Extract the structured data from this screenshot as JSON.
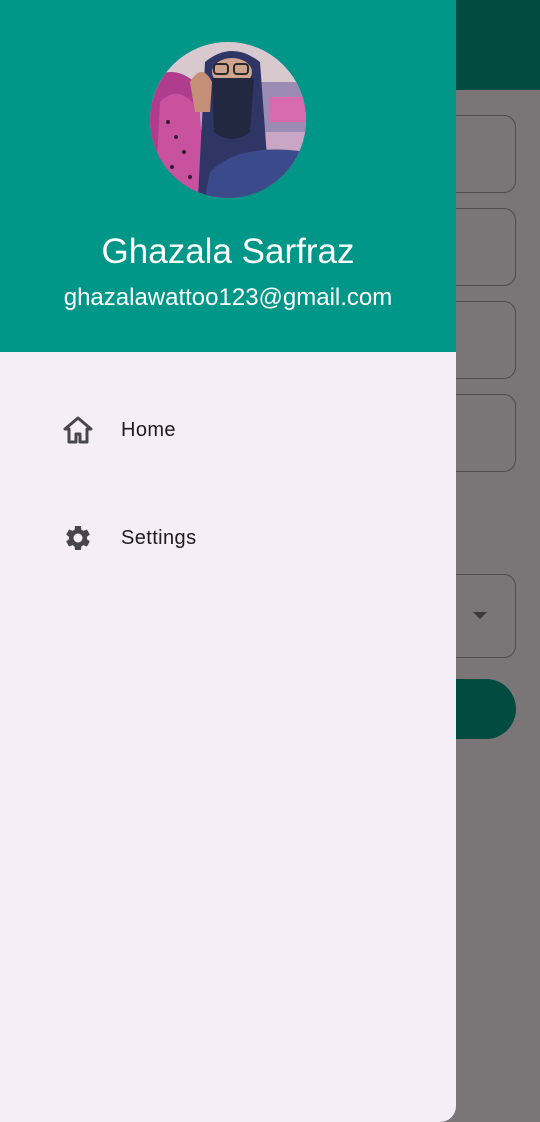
{
  "drawer": {
    "account": {
      "name": "Ghazala Sarfraz",
      "email": "ghazalawattoo123@gmail.com",
      "avatar": "profile-photo"
    },
    "items": [
      {
        "label": "Home",
        "icon": "home-icon"
      },
      {
        "label": "Settings",
        "icon": "gear-icon"
      }
    ]
  },
  "colors": {
    "header": "#009688",
    "drawer_bg": "#f6eef7",
    "scrim": "#7a7577",
    "appbar": "#024b40"
  }
}
